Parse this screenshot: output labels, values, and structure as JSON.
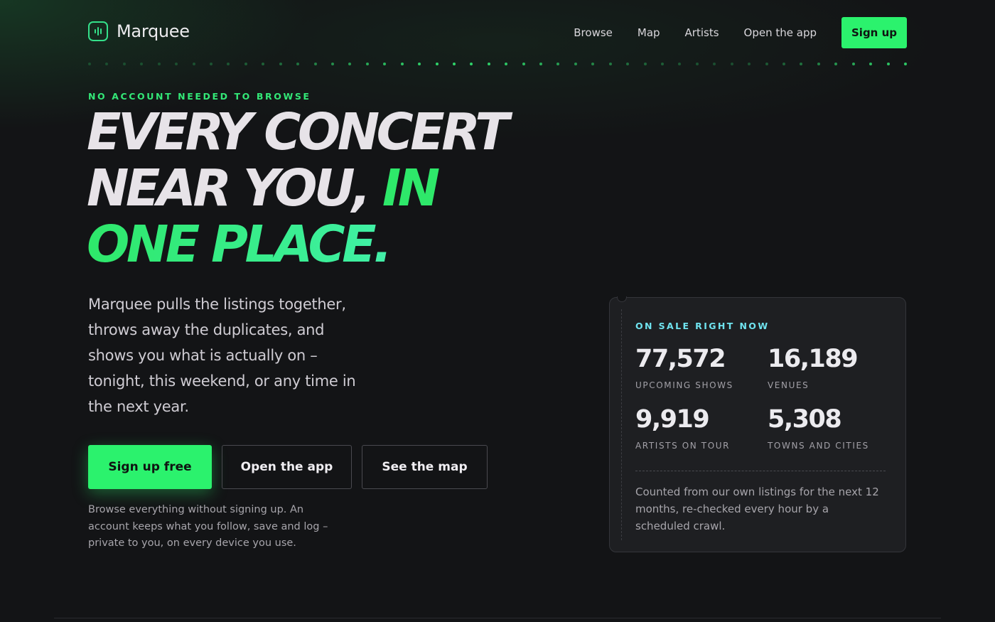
{
  "header": {
    "brand": "Marquee",
    "brand_icon": "equalizer-icon",
    "nav": {
      "browse": "Browse",
      "map": "Map",
      "artists": "Artists",
      "open_app": "Open the app",
      "signup": "Sign up"
    }
  },
  "hero": {
    "eyebrow": "NO ACCOUNT NEEDED TO BROWSE",
    "headline_line1": "EVERY CONCERT",
    "headline_line2_white": "NEAR YOU, ",
    "headline_line2_green": "IN",
    "headline_line3": "ONE PLACE.",
    "lede": "Marquee pulls the listings together, throws away the duplicates, and shows you what is actually on – tonight, this weekend, or any time in the next year.",
    "buttons": {
      "signup_free": "Sign up free",
      "open_app": "Open the app",
      "see_map": "See the map"
    },
    "footnote": "Browse everything without signing up. An account keeps what you follow, save and log – private to you, on every device you use."
  },
  "stats_card": {
    "eyebrow": "ON SALE RIGHT NOW",
    "stats": [
      {
        "value": "77,572",
        "label": "UPCOMING SHOWS"
      },
      {
        "value": "16,189",
        "label": "VENUES"
      },
      {
        "value": "9,919",
        "label": "ARTISTS ON TOUR"
      },
      {
        "value": "5,308",
        "label": "TOWNS AND CITIES"
      }
    ],
    "note": "Counted from our own listings for the next 12 months, re-checked every hour by a scheduled crawl."
  },
  "colors": {
    "accent": "#2bf26d",
    "accent_cyan": "#6fe3ef",
    "background": "#131416",
    "card": "#1e1f22"
  }
}
